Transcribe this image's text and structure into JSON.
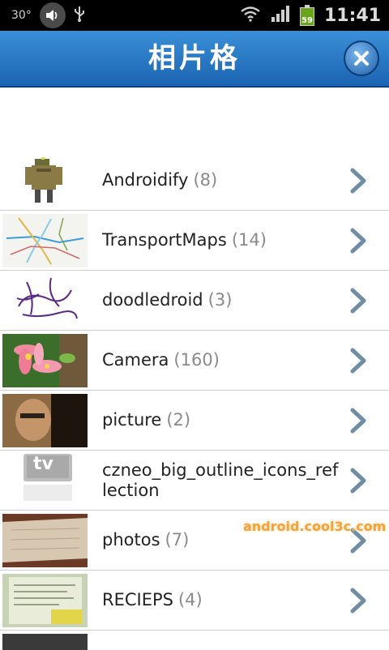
{
  "status": {
    "temp": "30°",
    "time": "11:41",
    "battery": "59"
  },
  "header": {
    "title": "相片格",
    "close_icon": "close-icon"
  },
  "albums": [
    {
      "name": "Androidify",
      "count": "(8)"
    },
    {
      "name": "TransportMaps",
      "count": "(14)"
    },
    {
      "name": "doodledroid",
      "count": "(3)"
    },
    {
      "name": "Camera",
      "count": "(160)"
    },
    {
      "name": "picture",
      "count": "(2)"
    },
    {
      "name": "czneo_big_outline_icons_reflection",
      "count": ""
    },
    {
      "name": "photos",
      "count": "(7)"
    },
    {
      "name": "RECIEPS",
      "count": "(4)"
    }
  ],
  "watermark": "android.cool3c.com",
  "colors": {
    "title_bar": "#1b64b3",
    "background": "#ffffff",
    "chevron": "#6f8ea5"
  }
}
